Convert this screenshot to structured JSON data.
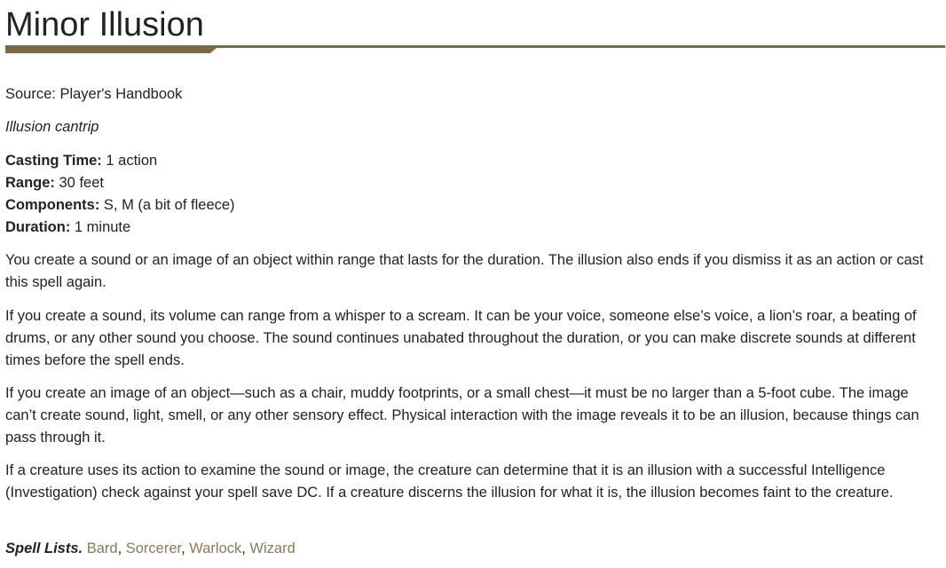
{
  "spell": {
    "title": "Minor Illusion",
    "source": "Source: Player's Handbook",
    "school": "Illusion cantrip",
    "casting_time_label": "Casting Time:",
    "casting_time_value": " 1 action",
    "range_label": "Range:",
    "range_value": " 30 feet",
    "components_label": "Components:",
    "components_value": " S, M (a bit of fleece)",
    "duration_label": "Duration:",
    "duration_value": " 1 minute",
    "paragraphs": [
      "You create a sound or an image of an object within range that lasts for the duration. The illusion also ends if you dismiss it as an action or cast this spell again.",
      "If you create a sound, its volume can range from a whisper to a scream. It can be your voice, someone else’s voice, a lion’s roar, a beating of drums, or any other sound you choose. The sound continues unabated throughout the duration, or you can make discrete sounds at different times before the spell ends.",
      "If you create an image of an object—such as a chair, muddy footprints, or a small chest—it must be no larger than a 5-foot cube. The image can’t create sound, light, smell, or any other sensory effect. Physical interaction with the image reveals it to be an illusion, because things can pass through it.",
      "If a creature uses its action to examine the sound or image, the creature can determine that it is an illusion with a successful Intelligence (Investigation) check against your spell save DC. If a creature discerns the illusion for what it is, the illusion becomes faint to the creature."
    ],
    "spell_lists_label": "Spell Lists.",
    "spell_lists": [
      "Bard",
      "Sorcerer",
      "Warlock",
      "Wizard"
    ]
  },
  "colors": {
    "accent": "#7a6a45",
    "link": "#8a7a55",
    "text": "#222222"
  }
}
